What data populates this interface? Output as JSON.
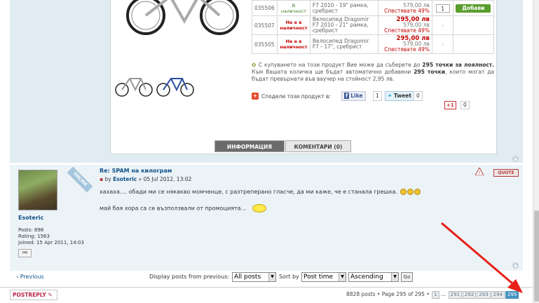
{
  "products": [
    {
      "code": "035506",
      "availability": "В наличност",
      "available": true,
      "name_line1": "F7 2010 - 19\" рамка,",
      "name_line2": "сребрист",
      "price_new": "",
      "price_old": "579,00 лв",
      "save": "Спестявате 49%",
      "qty": "1",
      "action": "Добави"
    },
    {
      "code": "035507",
      "availability": "Не е в наличност",
      "available": false,
      "name_line1": "Велосипед Dragomir",
      "name_line2": "F7 2010 - 21\" рамка, сребрист",
      "price_new": "295,00 лв",
      "price_old": "579,00 лв",
      "save": "Спестявате 49%",
      "qty": "-",
      "action": ""
    },
    {
      "code": "035505",
      "availability": "Не е в наличност",
      "available": false,
      "name_line1": "Велосипед Dragomir",
      "name_line2": "F7 - 17\", сребрист",
      "price_new": "295,00 лв",
      "price_old": "579,00 лв",
      "save": "Спестявате 49%",
      "qty": "-",
      "action": ""
    }
  ],
  "loyalty": {
    "part1": "С купуването на този продукт Вие може да съберете до ",
    "points1": "295 точки за лоялност.",
    "part2": " Към Вашата количка ще бъдат автоматично добавени ",
    "points2": "295 точки",
    "part3": ", които могат да бъдат превърнати във ваучер на стойност 2,95 лв."
  },
  "share": {
    "label": "Сподели този продукт в:",
    "fb_like": "Like",
    "fb_count": "1",
    "tweet": "Tweet",
    "tweet_count": "0",
    "gplus": "+1",
    "gplus_count": "0"
  },
  "tabs": {
    "info": "ИНФОРМАЦИЯ",
    "comments": "КОМЕНТАРИ (0)"
  },
  "post": {
    "title": "Re: SPAM на килограм",
    "by": "by",
    "author": "Esoteric",
    "date": "» 05 Jul 2012, 13:02",
    "line1": "хахаха.... обади ми се някакво момченце, с разтреперано гласче, да ми каже, че е станала грешка.",
    "line2": "май бая хора са се възползвали от промоцията...",
    "quote": "QUOTE",
    "online": "ONLINE"
  },
  "profile": {
    "username": "Esoteric",
    "posts": "Posts: 898",
    "rating": "Rating: 1563",
    "joined": "Joined: 15 Apr 2011, 14:03",
    "pm": "PM"
  },
  "nav": {
    "previous": "‹ Previous",
    "display_label": "Display posts from previous:",
    "display_value": "All posts",
    "sort_label": "Sort by",
    "sort_value": "Post time",
    "order_value": "Ascending",
    "go": "Go"
  },
  "bottom": {
    "postreply": "POSTREPLY",
    "summary": "8828 posts • Page 295 of 295 •",
    "pages": [
      "1",
      "...",
      "291",
      "292",
      "293",
      "294",
      "295"
    ],
    "current_page": "295"
  },
  "colors": {
    "accent": "#105289",
    "price_red": "#c40000",
    "arrow_red": "#e8201a"
  }
}
